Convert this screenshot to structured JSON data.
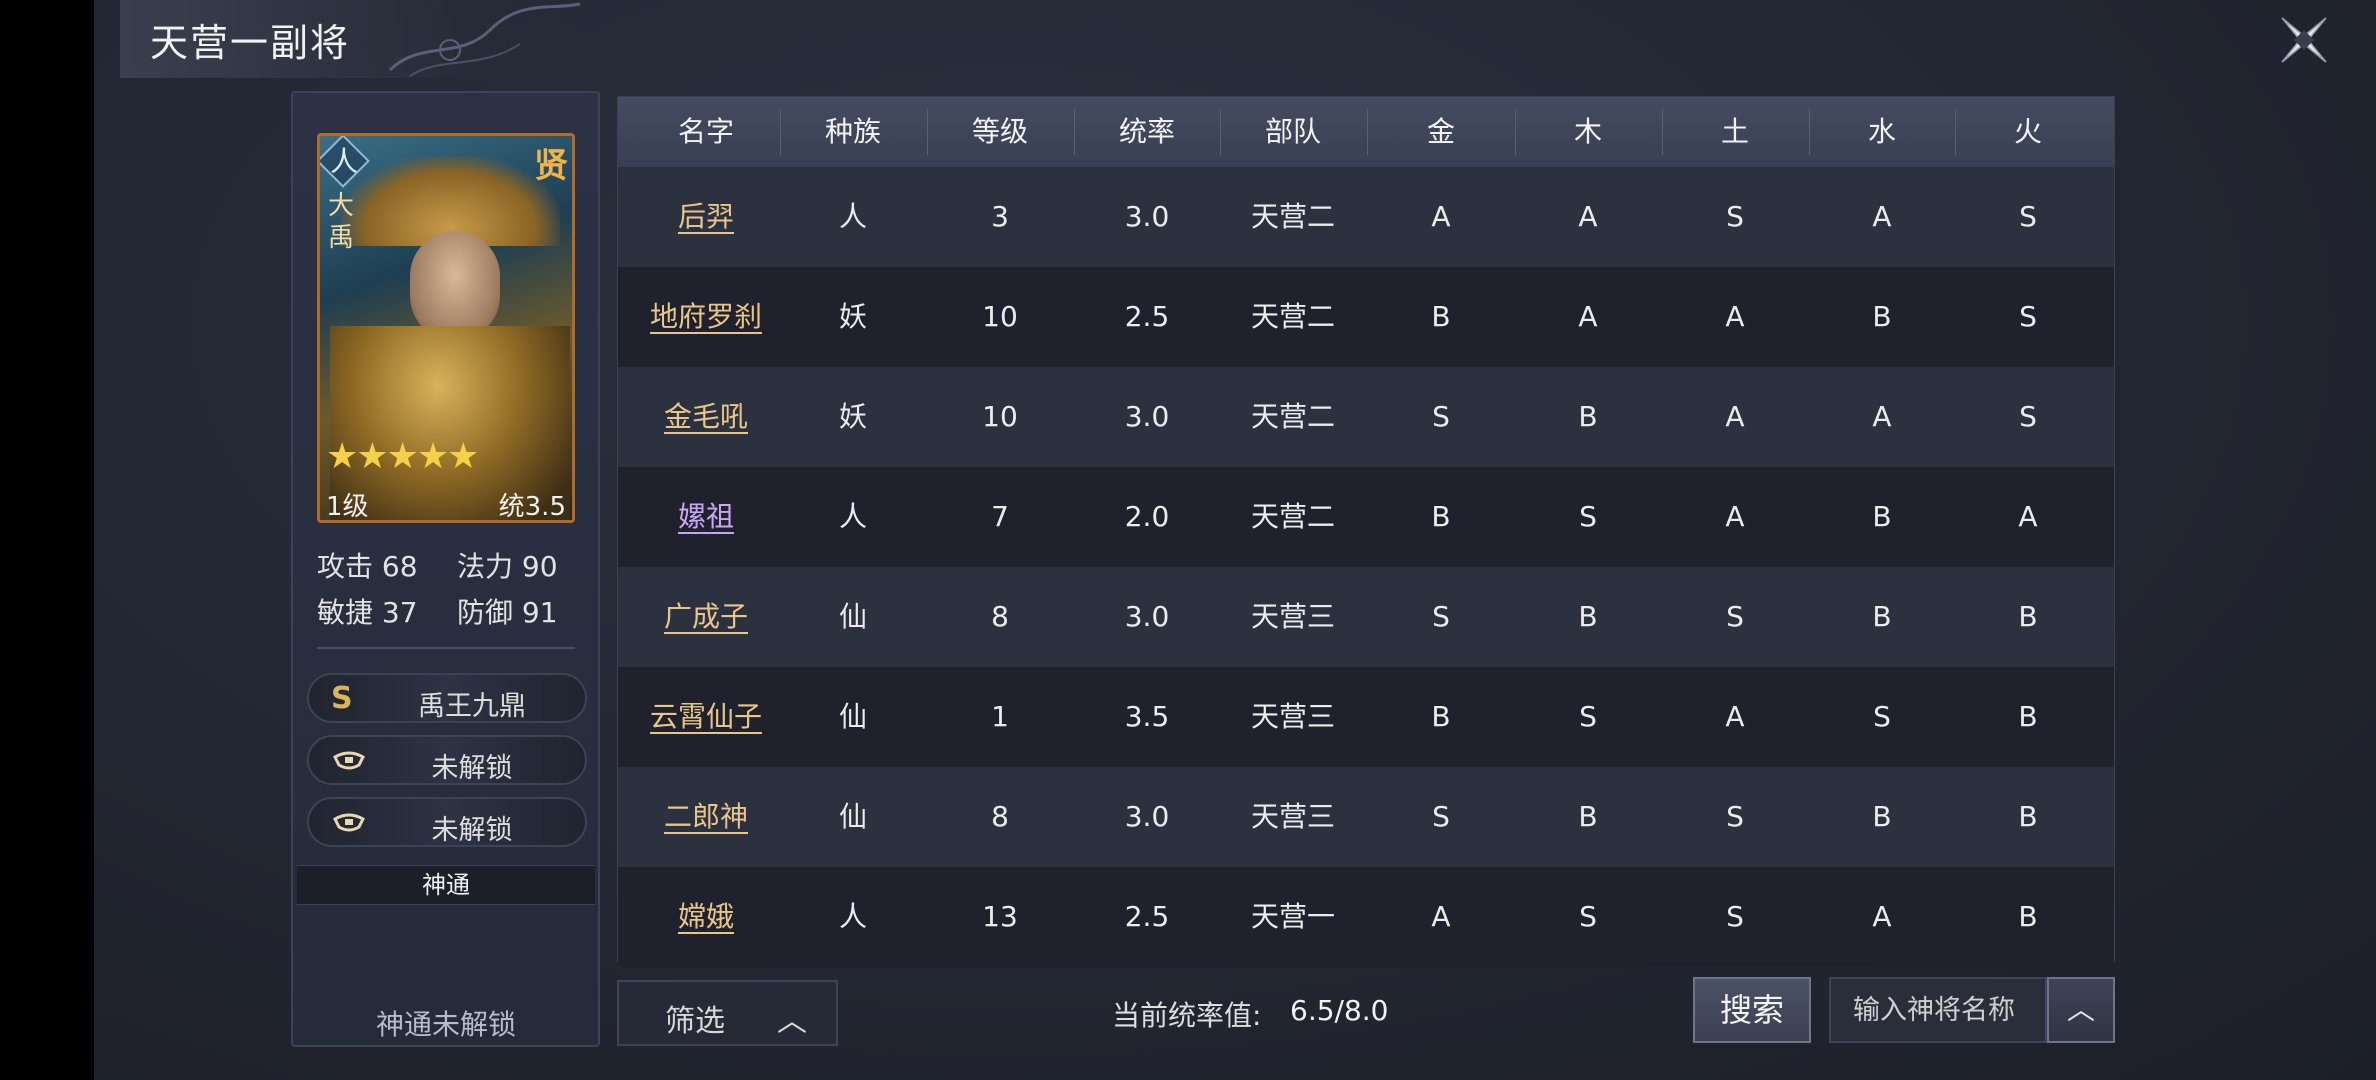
{
  "title": "天营一副将",
  "hero": {
    "race": "人",
    "rarity": "贤",
    "name": "大禹",
    "stars": "★★★★★",
    "level": "1级",
    "command": "统3.5",
    "stats": [
      {
        "label": "攻击 68"
      },
      {
        "label": "法力 90"
      },
      {
        "label": "敏捷 37"
      },
      {
        "label": "防御 91"
      }
    ]
  },
  "skills": [
    {
      "icon": "S",
      "label": "禹王九鼎",
      "icon_name": "s-rank-icon"
    },
    {
      "icon": "",
      "label": "未解锁",
      "icon_name": "lock-icon"
    },
    {
      "icon": "",
      "label": "未解锁",
      "icon_name": "lock-icon"
    }
  ],
  "shentong": {
    "header": "神通",
    "body": "神通未解锁"
  },
  "table": {
    "headers": [
      "名字",
      "种族",
      "等级",
      "统率",
      "部队",
      "金",
      "木",
      "土",
      "水",
      "火"
    ],
    "rows": [
      {
        "name": "后羿",
        "race": "人",
        "level": "3",
        "command": "3.0",
        "army": "天营二",
        "jin": "A",
        "mu": "A",
        "tu": "S",
        "shui": "A",
        "huo": "S",
        "color": "#e9c58a"
      },
      {
        "name": "地府罗刹",
        "race": "妖",
        "level": "10",
        "command": "2.5",
        "army": "天营二",
        "jin": "B",
        "mu": "A",
        "tu": "A",
        "shui": "B",
        "huo": "S",
        "color": "#e9c58a"
      },
      {
        "name": "金毛吼",
        "race": "妖",
        "level": "10",
        "command": "3.0",
        "army": "天营二",
        "jin": "S",
        "mu": "B",
        "tu": "A",
        "shui": "A",
        "huo": "S",
        "color": "#e9c58a"
      },
      {
        "name": "嫘祖",
        "race": "人",
        "level": "7",
        "command": "2.0",
        "army": "天营二",
        "jin": "B",
        "mu": "S",
        "tu": "A",
        "shui": "B",
        "huo": "A",
        "color": "#c9a6f2"
      },
      {
        "name": "广成子",
        "race": "仙",
        "level": "8",
        "command": "3.0",
        "army": "天营三",
        "jin": "S",
        "mu": "B",
        "tu": "S",
        "shui": "B",
        "huo": "B",
        "color": "#e9c58a"
      },
      {
        "name": "云霄仙子",
        "race": "仙",
        "level": "1",
        "command": "3.5",
        "army": "天营三",
        "jin": "B",
        "mu": "S",
        "tu": "A",
        "shui": "S",
        "huo": "B",
        "color": "#e9c58a"
      },
      {
        "name": "二郎神",
        "race": "仙",
        "level": "8",
        "command": "3.0",
        "army": "天营三",
        "jin": "S",
        "mu": "B",
        "tu": "S",
        "shui": "B",
        "huo": "B",
        "color": "#e9c58a"
      },
      {
        "name": "嫦娥",
        "race": "人",
        "level": "13",
        "command": "2.5",
        "army": "天营一",
        "jin": "A",
        "mu": "S",
        "tu": "S",
        "shui": "A",
        "huo": "B",
        "color": "#e9c58a"
      }
    ]
  },
  "bottom": {
    "filter_label": "筛选",
    "filter_chevron": "︿",
    "ratio_label": "当前统率值:",
    "ratio_value": "6.5/8.0",
    "search_label": "搜索",
    "search_placeholder": "输入神将名称",
    "expand_chevron": "︿"
  }
}
